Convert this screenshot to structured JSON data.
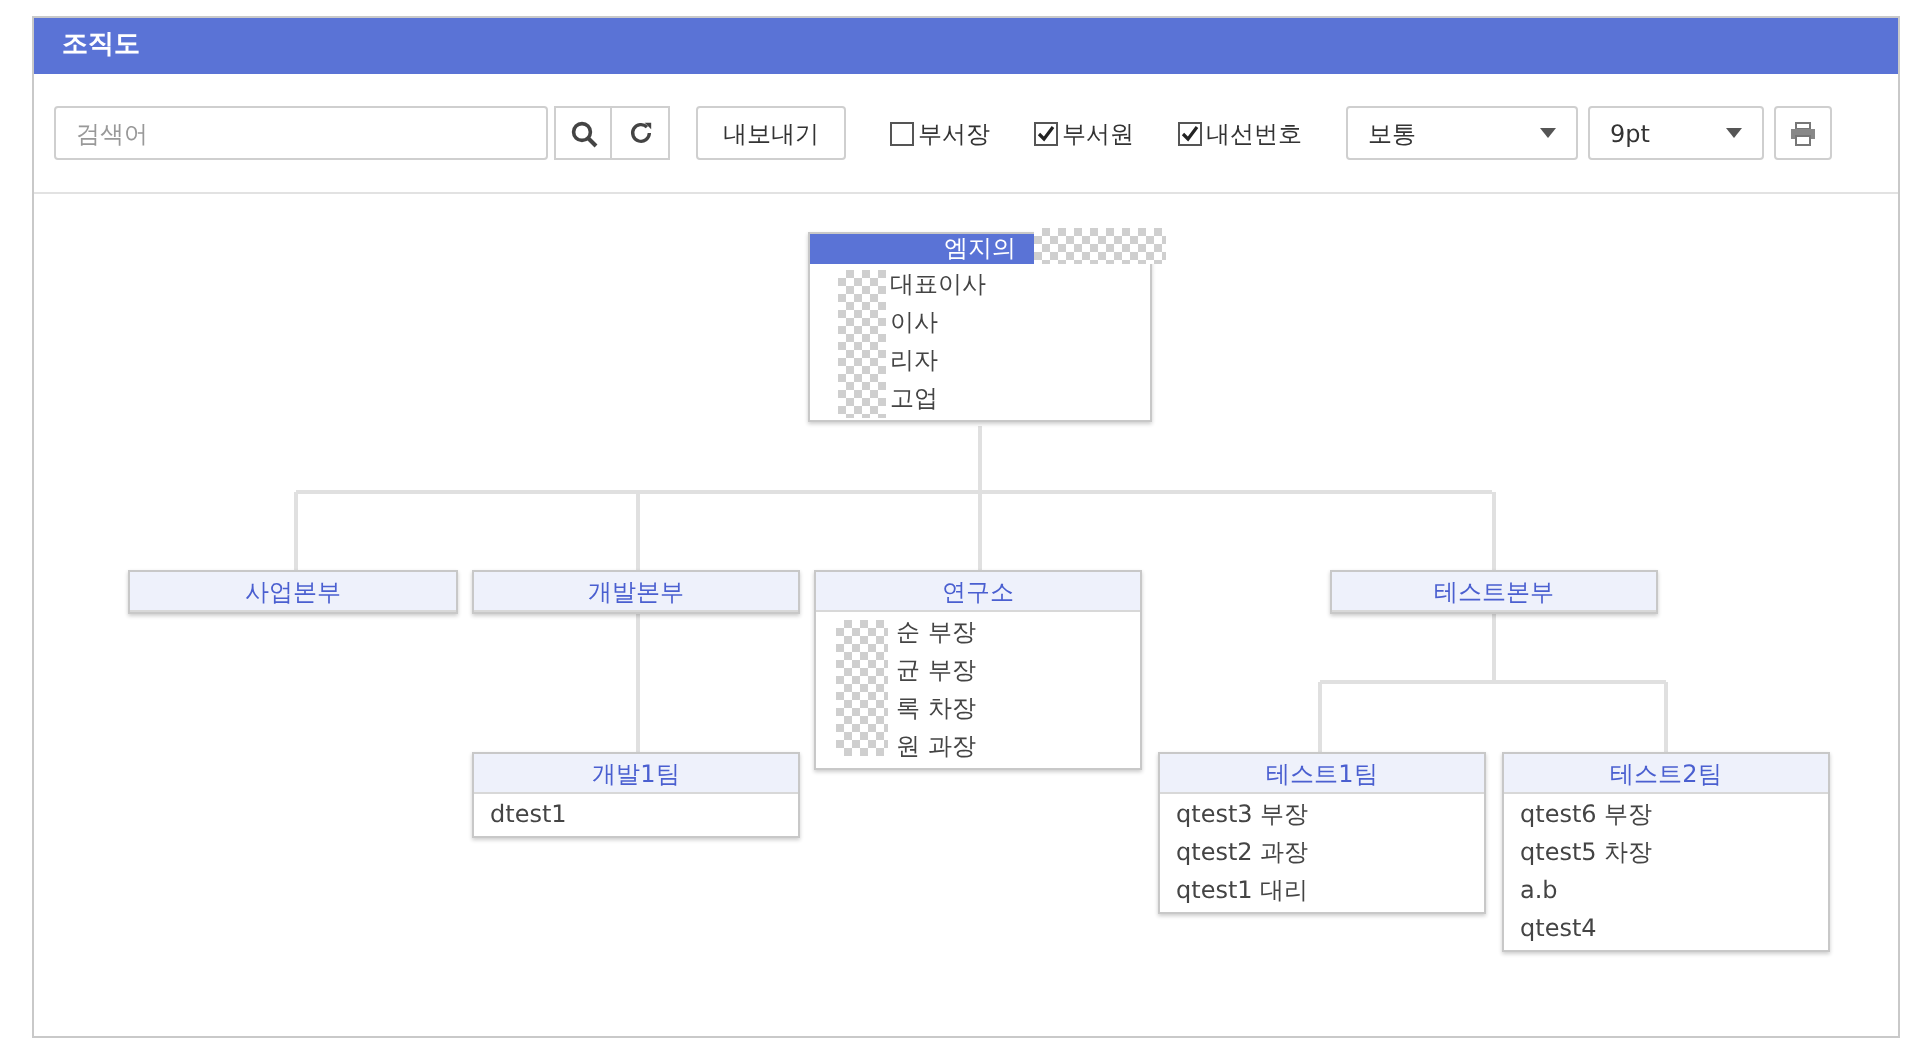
{
  "window": {
    "title": "조직도"
  },
  "toolbar": {
    "search": {
      "placeholder": "검색어"
    },
    "export_button": "내보내기",
    "checkboxes": [
      {
        "label": "부서장",
        "checked": false
      },
      {
        "label": "부서원",
        "checked": true
      },
      {
        "label": "내선번호",
        "checked": true
      }
    ],
    "selects": [
      {
        "value": "보통"
      },
      {
        "value": "9pt"
      }
    ]
  },
  "org_chart": {
    "title": "엠지의",
    "redacted": true,
    "members": [
      "대표이사",
      "이사",
      "리자",
      "고업"
    ],
    "children": [
      {
        "title": "사업본부"
      },
      {
        "title": "개발본부",
        "children": [
          {
            "title": "개발1팀",
            "members": [
              "dtest1"
            ]
          }
        ]
      },
      {
        "title": "연구소",
        "redacted": true,
        "members": [
          "순 부장",
          "균 부장",
          "록 차장",
          "원 과장"
        ]
      },
      {
        "title": "테스트본부",
        "children": [
          {
            "title": "테스트1팀",
            "members": [
              "qtest3 부장",
              "qtest2 과장",
              "qtest1 대리"
            ]
          },
          {
            "title": "테스트2팀",
            "members": [
              "qtest6 부장",
              "qtest5 차장",
              "a.b",
              "qtest4"
            ]
          }
        ]
      }
    ]
  }
}
